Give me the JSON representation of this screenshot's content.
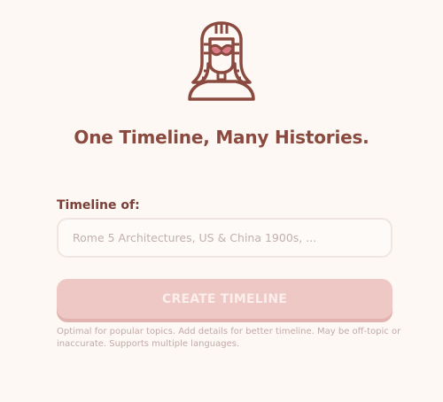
{
  "header": {
    "logo_icon": "pharaoh-icon",
    "title": "One Timeline, Many Histories."
  },
  "form": {
    "label": "Timeline of:",
    "input": {
      "value": "",
      "placeholder": "Rome 5 Architectures, US & China 1900s, ..."
    },
    "button_label": "CREATE TIMELINE",
    "helper_text": "Optimal for popular topics. Add details for better timeline. May be off-topic or inaccurate. Supports multiple languages."
  },
  "colors": {
    "background": "#fdf8f3",
    "brand": "#8b4a40",
    "button": "#eec8c4",
    "accent": "#d97b86"
  }
}
